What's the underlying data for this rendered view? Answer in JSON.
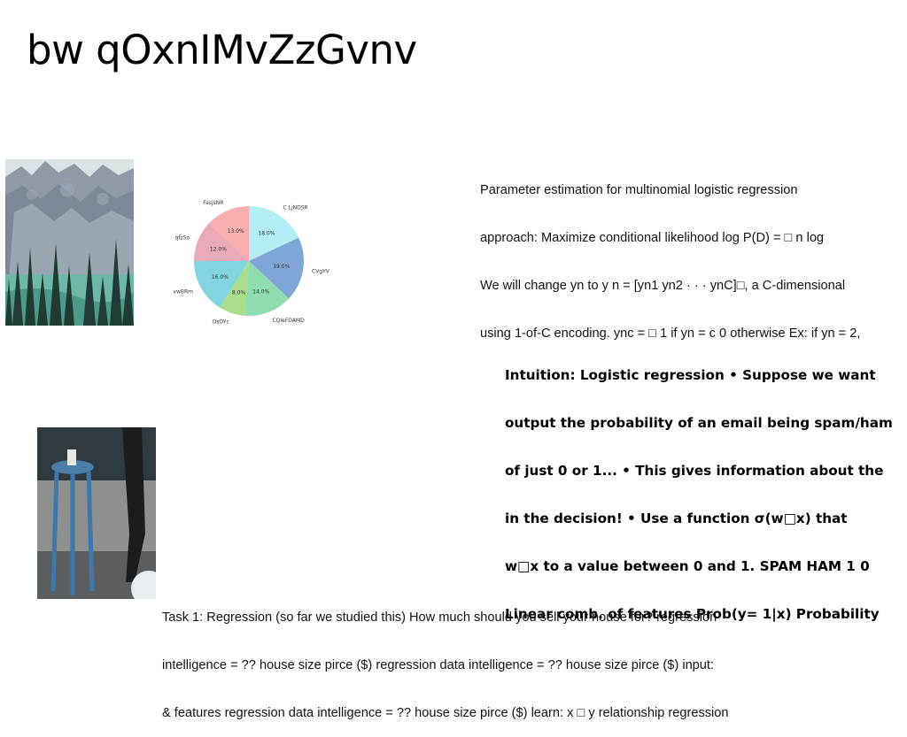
{
  "slide": {
    "title": "bw qOxnIMvZzGvnv"
  },
  "text_block_1": {
    "lines": [
      "Parameter estimation for multinomial logistic regression",
      "approach: Maximize conditional likelihood log P(D) = □ n log",
      "We will change yn to y n = [yn1 yn2 · · · ynC]□, a C-dimensional",
      "using 1-of-C encoding. ync = □ 1 if yn = c 0 otherwise Ex: if yn = 2,"
    ]
  },
  "text_block_2": {
    "lines": [
      "Intuition: Logistic regression • Suppose we want",
      "output the probability of an email being spam/ham",
      "of just 0 or 1... • This gives information about the",
      "in the decision! • Use a function σ(w□x) that",
      "w□x to a value between 0 and 1. SPAM HAM 1 0",
      "Linear comb. of features Prob(y= 1|x) Probability"
    ]
  },
  "text_block_3": {
    "lines": [
      "Task 1: Regression (so far we studied this) How much should you sell your house for? regression",
      "intelligence = ?? house size pirce ($) regression data intelligence = ?? house size pirce ($) input:",
      "& features regression data intelligence = ?? house size pirce ($) learn: x □ y relationship regression"
    ]
  },
  "images": {
    "photo1": "mountain-forest-photo",
    "photo2": "blue-stool-photo"
  },
  "chart_data": {
    "type": "pie",
    "title": "",
    "start_angle_deg": 90,
    "direction": "clockwise",
    "labels": [
      "C LjNDSR",
      "CVgYV",
      "CQIeFDAMD",
      "OsOYc",
      "vwBRm",
      "qfzSo",
      "FasjsNR"
    ],
    "values": [
      18.0,
      19.0,
      14.0,
      8.0,
      16.0,
      12.0,
      13.0
    ],
    "value_labels": [
      "18.0%",
      "19.0%",
      "14.0%",
      "8.0%",
      "16.0%",
      "12.0%",
      "13.0%"
    ],
    "colors": [
      "#b2eef5",
      "#7fa6d6",
      "#8fdcb0",
      "#a9dc8c",
      "#82d5e0",
      "#e8a9b8",
      "#f7aeae"
    ]
  }
}
